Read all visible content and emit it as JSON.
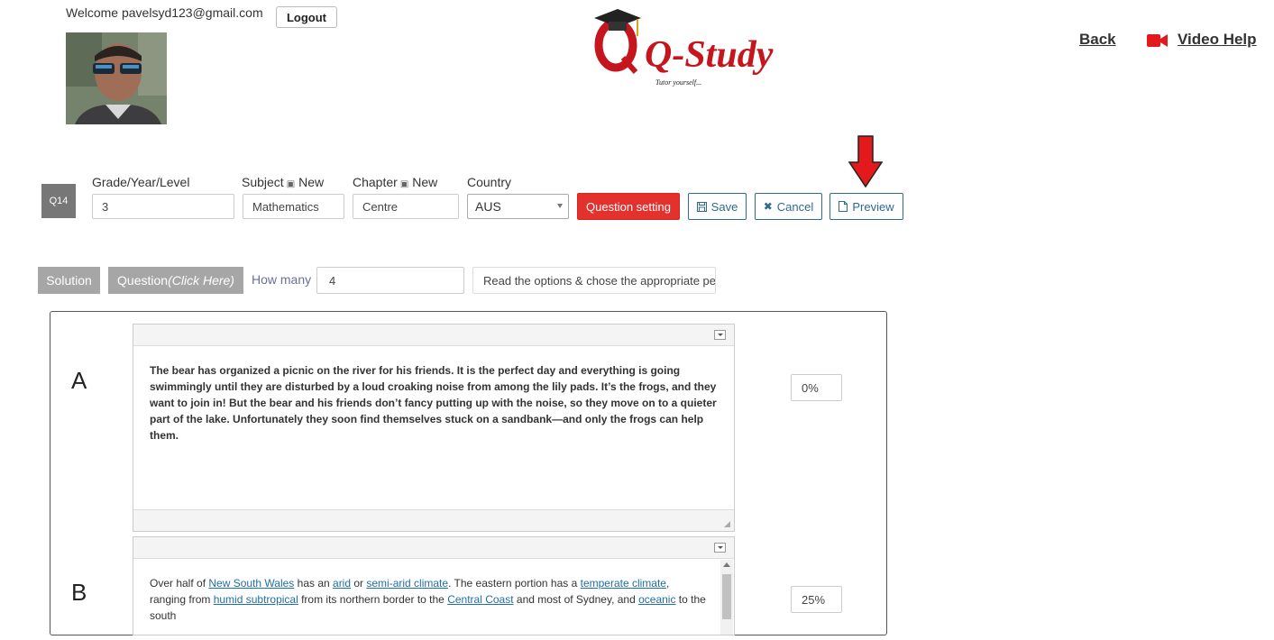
{
  "header": {
    "welcome_text": "Welcome pavelsyd123@gmail.com",
    "logout_label": "Logout",
    "logo_text": "Q-Study",
    "logo_tagline": "Tutor yourself...",
    "back_label": "Back",
    "video_help_label": "Video Help"
  },
  "toolbar": {
    "question_badge": "Q14",
    "grade_label": "Grade/Year/Level",
    "grade_value": "3",
    "subject_label": "Subject",
    "subject_new": "New",
    "subject_value": "Mathematics",
    "chapter_label": "Chapter",
    "chapter_new": "New",
    "chapter_value": "Centre",
    "country_label": "Country",
    "country_value": "AUS",
    "question_setting_label": "Question setting",
    "save_label": "Save",
    "cancel_label": "Cancel",
    "preview_label": "Preview"
  },
  "tabs": {
    "solution_label": "Solution",
    "question_label": "Question",
    "question_hint": "(Click Here)",
    "how_many_label": "How many",
    "how_many_value": "4",
    "instruction_value": "Read the options & chose the appropriate pe"
  },
  "options": [
    {
      "letter": "A",
      "text": "The bear has organized a picnic on the river for his friends. It is the perfect day and everything is going swimmingly until they are disturbed by a loud croaking noise from among the lily pads. It’s the frogs, and they want to join in! But the bear and his friends don’t fancy putting up with the noise, so they move on to a quieter part of the lake. Unfortunately they soon find themselves stuck on a sandbank—and only the frogs can help them.",
      "percent": "0%"
    },
    {
      "letter": "B",
      "segments": {
        "s1": "Over half of ",
        "l1": "New South Wales",
        "s2": " has an ",
        "l2": "arid",
        "s3": " or ",
        "l3": "semi-arid climate",
        "s4": ". The eastern portion has a ",
        "l4": "temperate climate",
        "s5": ", ranging from ",
        "l5": "humid subtropical",
        "s6": " from its northern border to the ",
        "l6": "Central Coast",
        "s7": " and most of Sydney, and ",
        "l7": "oceanic",
        "s8": " to the south"
      },
      "percent": "25%"
    }
  ],
  "colors": {
    "danger": "#e3312e",
    "outline": "#2e6b8f",
    "tab_gray": "#a6a6a6",
    "arrow": "#e3191b"
  }
}
